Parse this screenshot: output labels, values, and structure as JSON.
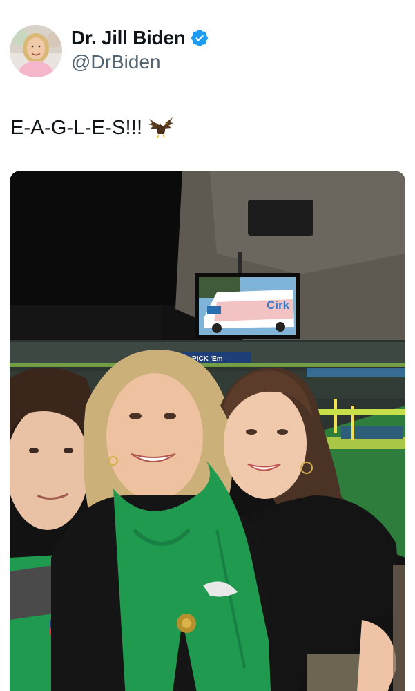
{
  "author": {
    "display_name": "Dr. Jill Biden",
    "handle": "@DrBiden",
    "verified": true,
    "verified_color": "#1d9bf0",
    "avatar_icon": "profile-photo"
  },
  "tweet": {
    "text": "E-A-G-L-E-S!!!",
    "emoji": "eagle-emoji"
  },
  "media": {
    "type": "photo",
    "tv_screen_text": "Cirk",
    "stadium_banner_text": "PICK 'Em"
  },
  "colors": {
    "text_primary": "#0f1419",
    "text_secondary": "#536471",
    "eagles_green": "#1f9a4f"
  }
}
